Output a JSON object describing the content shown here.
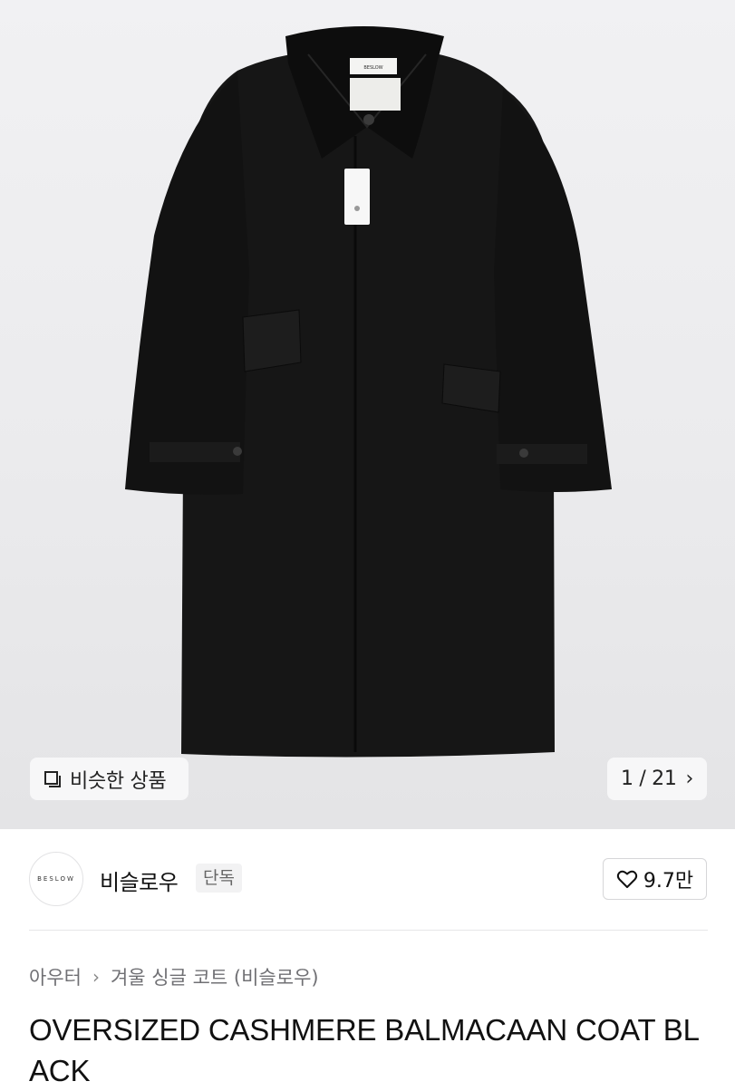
{
  "hero": {
    "similar_label": "비슷한 상품",
    "similar_icon": "copy-icon",
    "counter": "1 / 21",
    "counter_icon": "chevron-right-icon",
    "chevron": "›",
    "brand_tag_text": "BESLOW"
  },
  "brand": {
    "logo_text": "BESLOW",
    "name": "비슬로우",
    "badge": "단독",
    "like_icon": "heart-icon",
    "like_count": "9.7만"
  },
  "breadcrumb": {
    "category": "아우터",
    "separator": "›",
    "subcategory": "겨울 싱글 코트 (비슬로우)"
  },
  "product": {
    "title": "OVERSIZED CASHMERE BALMACAAN COAT BLACK"
  }
}
